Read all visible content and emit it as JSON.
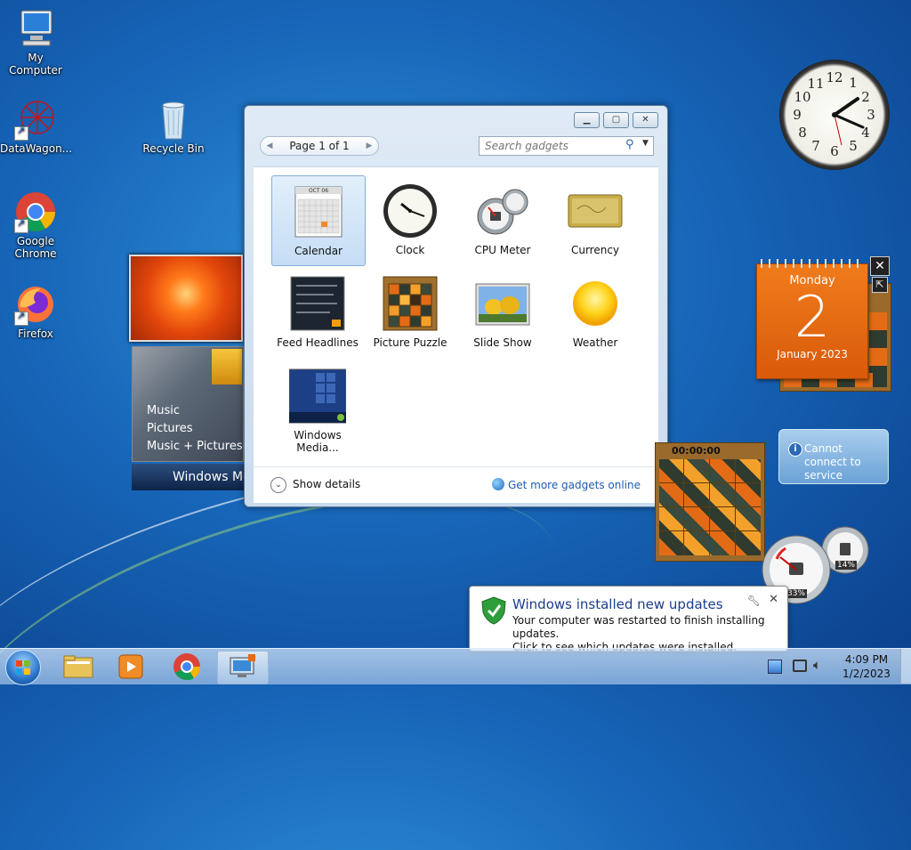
{
  "desktop": {
    "icons": [
      {
        "label": "My Computer"
      },
      {
        "label": "DataWagon..."
      },
      {
        "label": "Google Chrome"
      },
      {
        "label": "Firefox"
      },
      {
        "label": "Recycle Bin"
      }
    ]
  },
  "media_gadget": {
    "menu": [
      "Music",
      "Pictures",
      "Music + Pictures"
    ],
    "title": "Windows Me"
  },
  "gallery": {
    "pager_text": "Page 1 of 1",
    "search_placeholder": "Search gadgets",
    "items": [
      {
        "label": "Calendar",
        "selected": true
      },
      {
        "label": "Clock"
      },
      {
        "label": "CPU Meter"
      },
      {
        "label": "Currency"
      },
      {
        "label": "Feed Headlines"
      },
      {
        "label": "Picture Puzzle"
      },
      {
        "label": "Slide Show"
      },
      {
        "label": "Weather"
      },
      {
        "label": "Windows Media..."
      }
    ],
    "calendar_thumb_month": "OCT 06",
    "show_details": "Show details",
    "get_more": "Get more gadgets online"
  },
  "clock_gadget": {
    "numbers": [
      "12",
      "1",
      "2",
      "3",
      "4",
      "5",
      "6",
      "7",
      "8",
      "9",
      "10",
      "11"
    ]
  },
  "calendar_gadget": {
    "day": "Monday",
    "date": "2",
    "month_year": "January 2023"
  },
  "puzzle_gadget": {
    "timer": "00:00:00"
  },
  "service_gadget": {
    "message": "Cannot connect to service"
  },
  "cpu_gadget": {
    "cpu": "33%",
    "memory": "14%"
  },
  "notification": {
    "title": "Windows installed new updates",
    "line1": "Your computer was restarted to finish installing updates.",
    "line2": "Click to see which updates were installed."
  },
  "taskbar": {
    "time": "4:09 PM",
    "date": "1/2/2023"
  },
  "colors": {
    "accent": "#1c5eb0",
    "calendar_orange": "#e8690f",
    "desktop_blue": "#1765b8"
  }
}
